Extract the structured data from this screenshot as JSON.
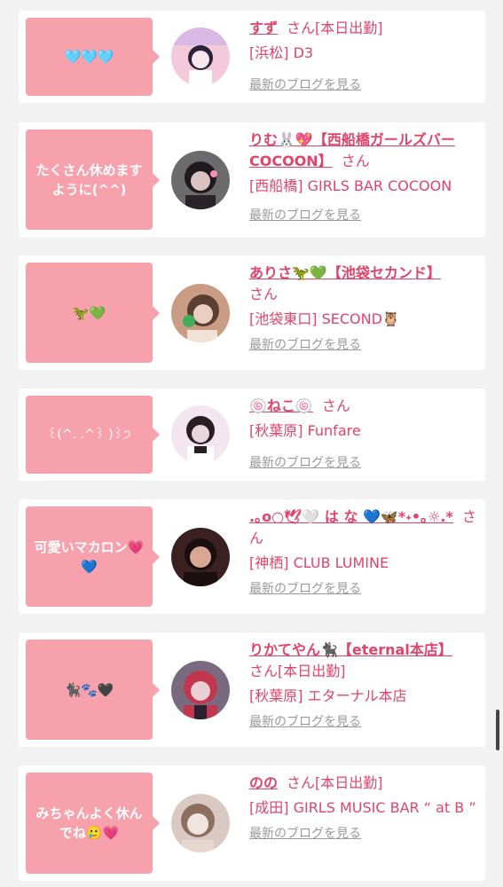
{
  "cards": [
    {
      "bubble": "🩵🩵🩵",
      "name": "すず",
      "san": "さん",
      "tag": "[本日出勤]",
      "shop": "[浜松] D3",
      "blog": "最新のブログを見る",
      "avatar_colors": [
        "#f4c9da",
        "#2b2336",
        "#f8e7ee"
      ]
    },
    {
      "bubble": "たくさん休めますように(^^)",
      "name": "りむ🐰💖【西船橋ガールズバーCOCOON】",
      "san": "さん",
      "tag": "",
      "shop": "[西船橋] GIRLS BAR COCOON",
      "blog": "最新のブログを見る",
      "avatar_colors": [
        "#6b6b6b",
        "#1e1a1d",
        "#d9c2bf"
      ]
    },
    {
      "bubble": "🦖💚",
      "name": "ありさ🦖💚【池袋セカンド】",
      "san": "さん",
      "tag": "",
      "shop": "[池袋東口] SECOND🦉",
      "blog": "最新のブログを見る",
      "avatar_colors": [
        "#c99c83",
        "#5a3f33",
        "#e8cfc0"
      ]
    },
    {
      "bubble": "꒰(^. .^꒱ )꒱੭",
      "name": "🍥ねこ🍥",
      "san": "さん",
      "tag": "",
      "shop": "[秋葉原] Funfare",
      "blog": "最新のブログを見る",
      "avatar_colors": [
        "#f3e6ee",
        "#2a1e22",
        "#e9d6dc"
      ]
    },
    {
      "bubble": "可愛いマカロン💗💙",
      "name": ".｡o○🕊🤍 は な 💙🦋*˖•｡☼.*",
      "san": "さん",
      "tag": "",
      "shop": "[神栖] CLUB LUMINE",
      "blog": "最新のブログを見る",
      "avatar_colors": [
        "#3a2020",
        "#1a0e0e",
        "#d8a894"
      ]
    },
    {
      "bubble": "🐈‍⬛🐾🖤",
      "name": "りかてやん🐈‍⬛【eternal本店】",
      "san": "さん",
      "tag": "[本日出勤]",
      "shop": "[秋葉原] エターナル本店",
      "blog": "最新のブログを見る",
      "avatar_colors": [
        "#7a6a80",
        "#c2364e",
        "#e8d0d4"
      ]
    },
    {
      "bubble": "みちゃんよく休んでね🥲💗",
      "name": "のの",
      "san": "さん",
      "tag": "[本日出勤]",
      "shop": "[成田] GIRLS MUSIC BAR “ at B ”",
      "blog": "最新のブログを見る",
      "avatar_colors": [
        "#d9c9c2",
        "#8c6f5e",
        "#f0e4de"
      ]
    }
  ]
}
